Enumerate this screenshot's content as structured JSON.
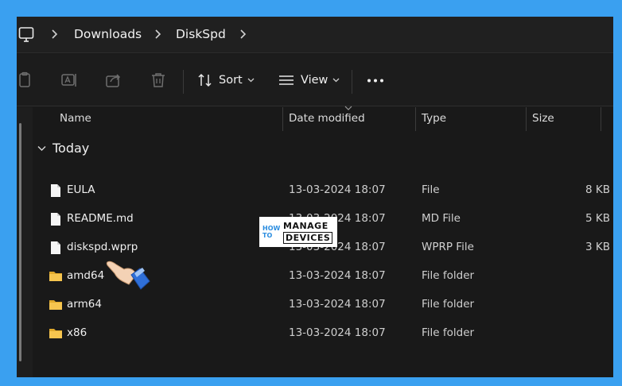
{
  "address_bar": {
    "root_icon": "monitor-icon",
    "crumbs": [
      "Downloads",
      "DiskSpd"
    ]
  },
  "toolbar": {
    "icons": [
      "paste-icon",
      "rename-icon",
      "share-icon",
      "delete-icon"
    ],
    "sort_label": "Sort",
    "view_label": "View",
    "more_icon": "more-icon"
  },
  "columns": {
    "name": "Name",
    "date": "Date modified",
    "type": "Type",
    "size": "Size"
  },
  "group_label": "Today",
  "files": [
    {
      "name": "EULA",
      "date": "13-03-2024 18:07",
      "type": "File",
      "size": "8 KB",
      "icon": "file-icon"
    },
    {
      "name": "README.md",
      "date": "13-03-2024 18:07",
      "type": "MD File",
      "size": "5 KB",
      "icon": "file-icon"
    },
    {
      "name": "diskspd.wprp",
      "date": "13-03-2024 18:07",
      "type": "WPRP File",
      "size": "3 KB",
      "icon": "file-icon"
    },
    {
      "name": "amd64",
      "date": "13-03-2024 18:07",
      "type": "File folder",
      "size": "",
      "icon": "folder-icon"
    },
    {
      "name": "arm64",
      "date": "13-03-2024 18:07",
      "type": "File folder",
      "size": "",
      "icon": "folder-icon"
    },
    {
      "name": "x86",
      "date": "13-03-2024 18:07",
      "type": "File folder",
      "size": "",
      "icon": "folder-icon"
    }
  ],
  "watermark": {
    "how": "HOW",
    "to": "TO",
    "manage": "MANAGE",
    "devices": "DEVICES"
  },
  "colors": {
    "frame": "#3aa0f0",
    "background": "#191919",
    "folder": "#f2c14e"
  }
}
